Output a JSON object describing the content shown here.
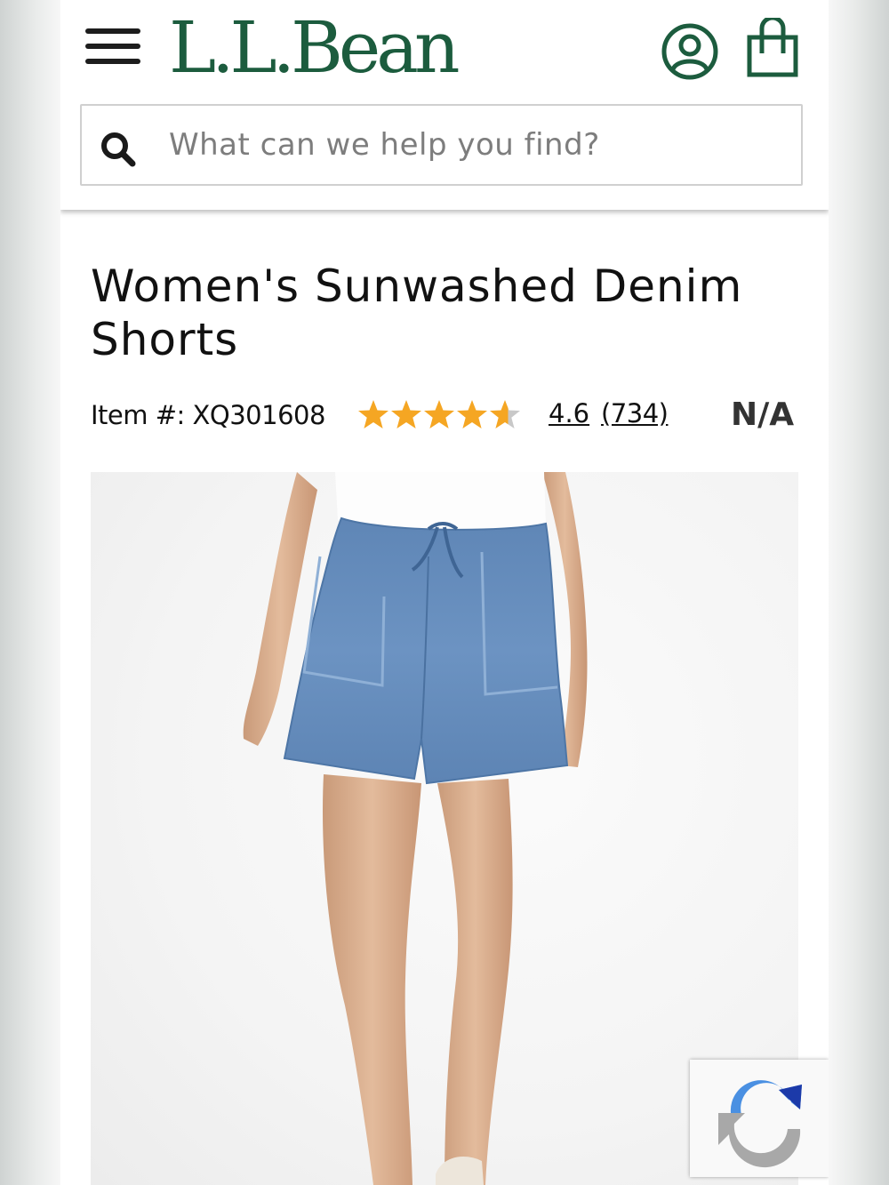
{
  "header": {
    "menu_icon": "hamburger-menu-icon",
    "logo_text": "L.L.Bean",
    "account_icon": "account-icon",
    "bag_icon": "shopping-bag-icon",
    "brand_color": "#1c5c3e"
  },
  "search": {
    "placeholder": "What can we help you find?",
    "icon": "search-icon"
  },
  "product": {
    "title": "Women's Sunwashed Denim Shorts",
    "item_number": "Item #: XQ301608",
    "rating": "4.6",
    "rating_stars": 4.6,
    "review_count": "(734)",
    "price": "N/A",
    "star_color": "#f5a623"
  },
  "widgets": {
    "recaptcha_icon": "recaptcha-icon"
  }
}
